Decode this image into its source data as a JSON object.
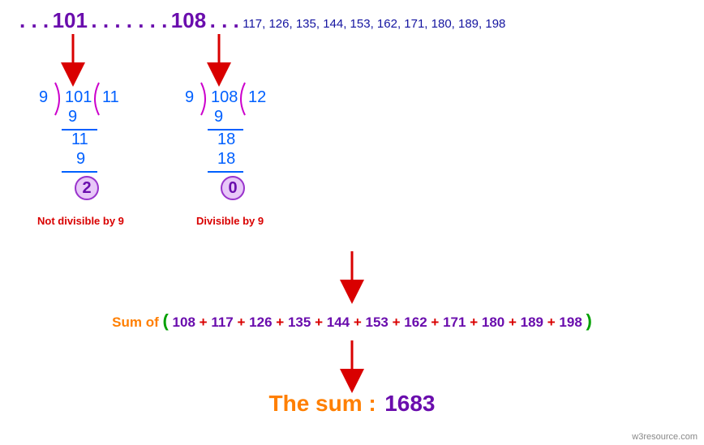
{
  "header": {
    "dots_before": ". . .",
    "number_a": "101",
    "dots_mid": ". . . . . . .",
    "number_b": "108",
    "dots_after": ". . .",
    "sequence": "117, 126, 135, 144, 153, 162, 171, 180, 189, 198"
  },
  "division_a": {
    "divisor": "9",
    "dividend": "101",
    "quotient": "11",
    "step1_sub": "9",
    "step2_val": "11",
    "step2_sub": "9",
    "remainder": "2",
    "verdict": "Not divisible by 9"
  },
  "division_b": {
    "divisor": "9",
    "dividend": "108",
    "quotient": "12",
    "step1_sub": "9",
    "step2_val": "18",
    "step2_sub": "18",
    "remainder": "0",
    "verdict": "Divisible by 9"
  },
  "sum_row": {
    "label": "Sum of",
    "open": "(",
    "terms": [
      "108",
      "117",
      "126",
      "135",
      "144",
      "153",
      "162",
      "171",
      "180",
      "189",
      "198"
    ],
    "close": ")",
    "joiner": "+"
  },
  "result": {
    "label": "The sum :",
    "value": "1683"
  },
  "footer": {
    "credit": "w3resource.com"
  },
  "chart_data": {
    "type": "table",
    "title": "Sum of 3-digit numbers from 101..198 divisible by 9",
    "divisor": 9,
    "candidates": [
      {
        "n": 101,
        "quotient": 11,
        "remainder": 2,
        "divisible": false
      },
      {
        "n": 108,
        "quotient": 12,
        "remainder": 0,
        "divisible": true
      }
    ],
    "divisible_numbers": [
      108,
      117,
      126,
      135,
      144,
      153,
      162,
      171,
      180,
      189,
      198
    ],
    "sum": 1683
  }
}
